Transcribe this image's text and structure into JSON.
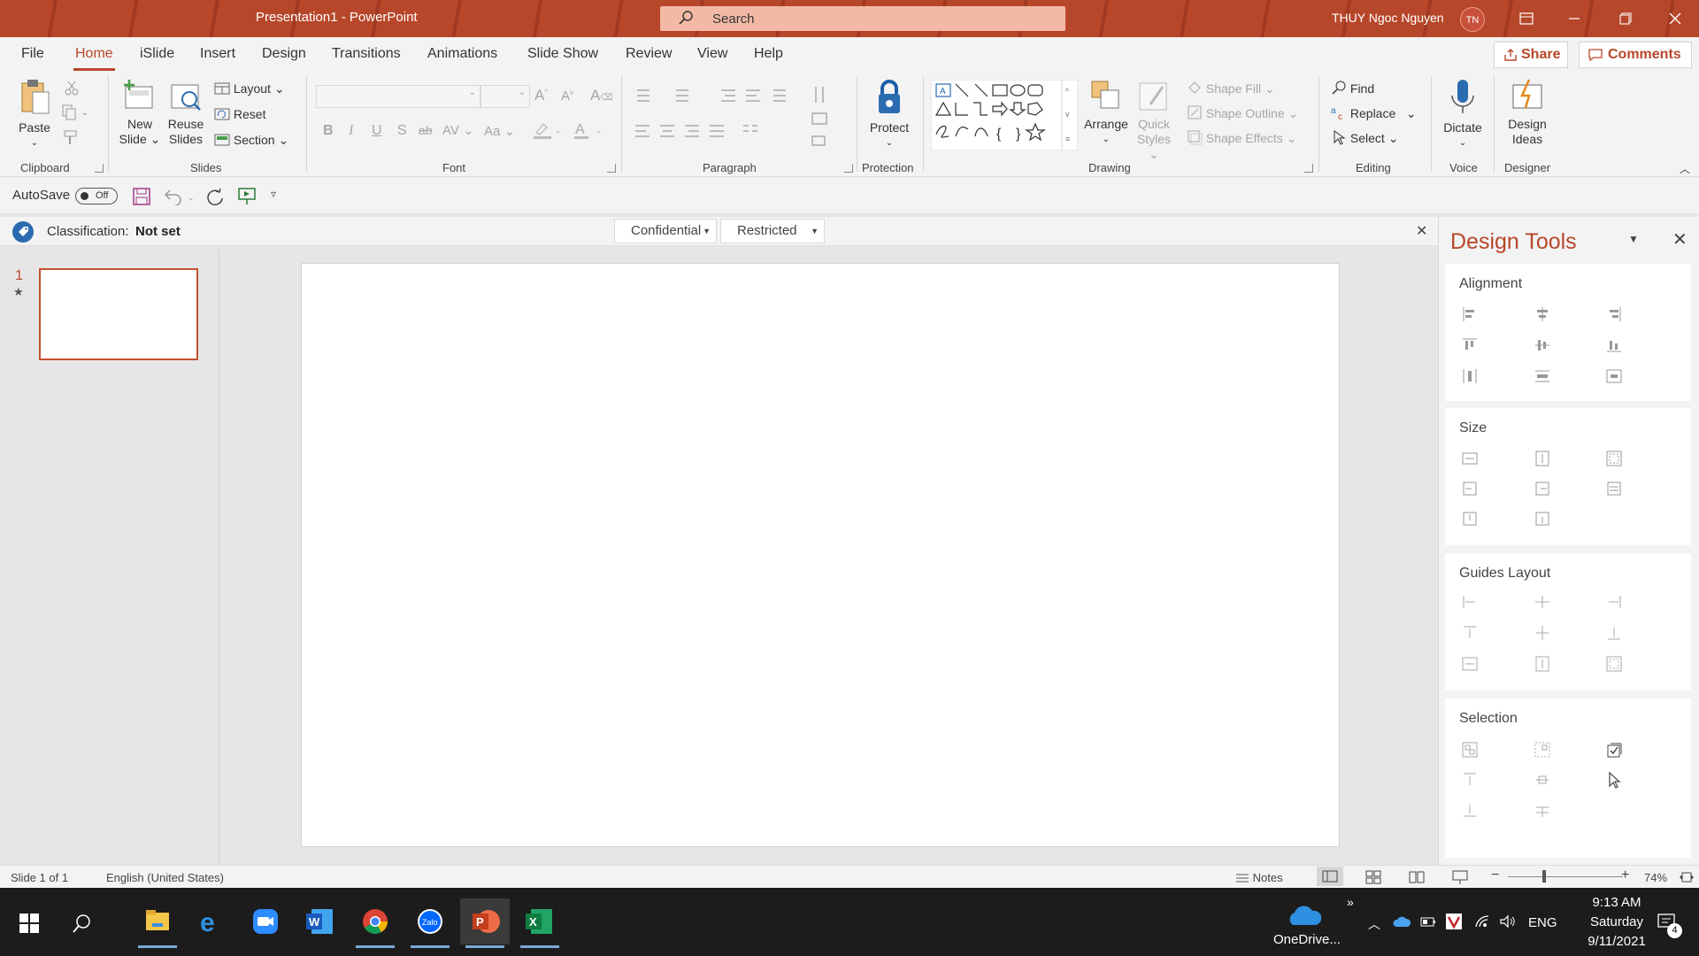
{
  "window": {
    "title": "Presentation1  -  PowerPoint",
    "search_placeholder": "Search",
    "user_name": "THUY Ngoc Nguyen",
    "user_initials": "TN"
  },
  "tabs": [
    {
      "label": "File"
    },
    {
      "label": "Home"
    },
    {
      "label": "iSlide"
    },
    {
      "label": "Insert"
    },
    {
      "label": "Design"
    },
    {
      "label": "Transitions"
    },
    {
      "label": "Animations"
    },
    {
      "label": "Slide Show"
    },
    {
      "label": "Review"
    },
    {
      "label": "View"
    },
    {
      "label": "Help"
    }
  ],
  "share_label": "Share",
  "comments_label": "Comments",
  "ribbon": {
    "clipboard": {
      "paste": "Paste",
      "group": "Clipboard"
    },
    "slides": {
      "new_slide_1": "New",
      "new_slide_2": "Slide",
      "reuse_1": "Reuse",
      "reuse_2": "Slides",
      "layout": "Layout",
      "reset": "Reset",
      "section": "Section",
      "group": "Slides"
    },
    "font": {
      "group": "Font",
      "case": "Aa"
    },
    "paragraph": {
      "group": "Paragraph"
    },
    "protection": {
      "protect": "Protect",
      "group": "Protection"
    },
    "drawing": {
      "arrange": "Arrange",
      "quick_1": "Quick",
      "quick_2": "Styles",
      "shape_fill": "Shape Fill",
      "shape_outline": "Shape Outline",
      "shape_effects": "Shape Effects",
      "group": "Drawing"
    },
    "editing": {
      "find": "Find",
      "replace": "Replace",
      "select": "Select",
      "group": "Editing"
    },
    "voice": {
      "dictate": "Dictate",
      "group": "Voice"
    },
    "designer": {
      "ideas_1": "Design",
      "ideas_2": "Ideas",
      "group": "Designer"
    }
  },
  "qat": {
    "autosave": "AutoSave",
    "toggle": "Off"
  },
  "classification": {
    "label": "Classification:",
    "value": "Not set",
    "options": [
      "Confidential",
      "Restricted"
    ]
  },
  "thumbnails": [
    {
      "number": "1"
    }
  ],
  "design_tools": {
    "title": "Design Tools",
    "sections": [
      "Alignment",
      "Size",
      "Guides Layout",
      "Selection"
    ]
  },
  "status": {
    "slide": "Slide 1 of 1",
    "language": "English (United States)",
    "notes": "Notes",
    "zoom": "74%"
  },
  "taskbar": {
    "onedrive": "OneDrive...",
    "lang": "ENG",
    "time": "9:13 AM",
    "day": "Saturday",
    "date": "9/11/2021",
    "notif": "4"
  }
}
